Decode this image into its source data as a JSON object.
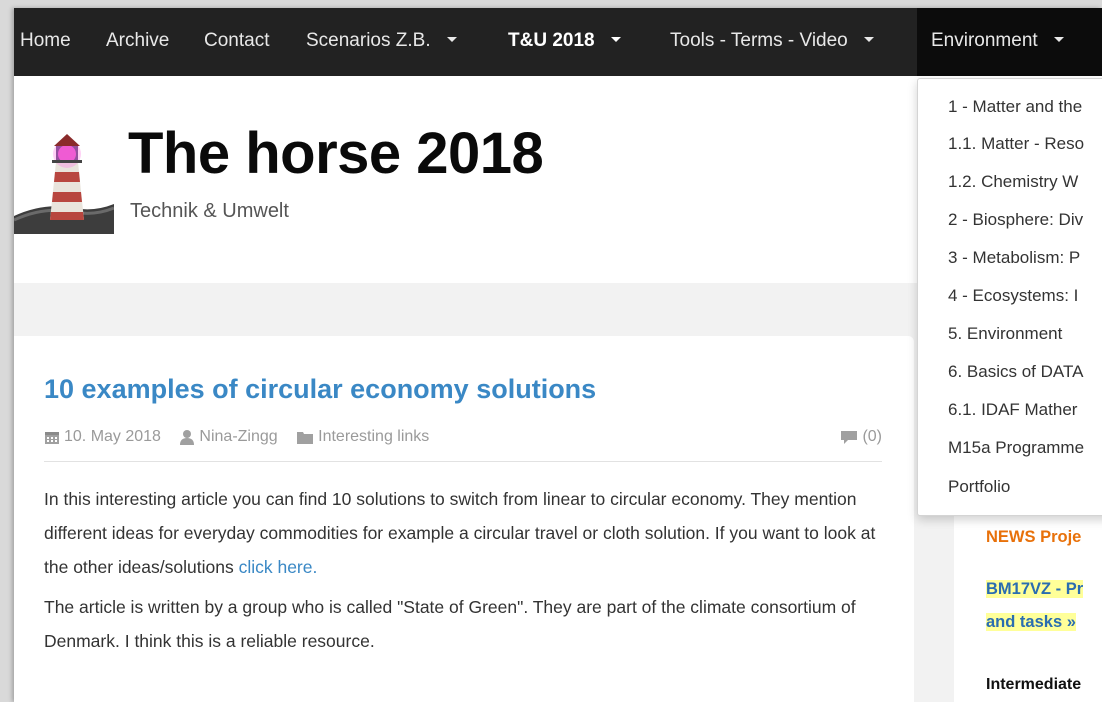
{
  "nav": {
    "items": [
      {
        "label": "Home"
      },
      {
        "label": "Archive"
      },
      {
        "label": "Contact"
      },
      {
        "label": "Scenarios Z.B."
      },
      {
        "label": "T&U 2018"
      },
      {
        "label": "Tools - Terms - Video"
      },
      {
        "label": "Environment"
      }
    ]
  },
  "header": {
    "title": "The horse 2018",
    "subtitle": "Technik & Umwelt"
  },
  "post": {
    "title": "10 examples of circular economy solutions",
    "date": "10. May 2018",
    "author": "Nina-Zingg",
    "category": "Interesting links",
    "comments": "(0)",
    "para1": "In this interesting article you can find 10 solutions to switch from linear to circular economy. They mention different ideas for everyday commodities for example a circular travel or cloth solution. If you want to look at the other ideas/solutions ",
    "link": "click here.",
    "para2": "The article is written by a group who is called \"State of Green\". They are part of the climate consortium of Denmark. I think this is a reliable resource."
  },
  "dropdown": {
    "items": [
      {
        "label": "1 - Matter and the"
      },
      {
        "label": "1.1. Matter - Reso"
      },
      {
        "label": "1.2. Chemistry W"
      },
      {
        "label": "2 - Biosphere: Div"
      },
      {
        "label": "3 - Metabolism: P"
      },
      {
        "label": "4 - Ecosystems: I"
      },
      {
        "label": "5. Environment"
      },
      {
        "label": "6. Basics of DATA"
      },
      {
        "label": "6.1. IDAF Mather"
      },
      {
        "label": "M15a Programme"
      },
      {
        "label": "Portfolio"
      }
    ]
  },
  "sidebar": {
    "news": "NEWS Proje",
    "bm_line1": "BM17VZ - Pr",
    "bm_line2": "and tasks »",
    "intermediate": "Intermediate"
  },
  "colors": {
    "navbar": "#222222",
    "link": "#3a88c5",
    "news": "#e8710a",
    "highlight": "#ffff99"
  }
}
